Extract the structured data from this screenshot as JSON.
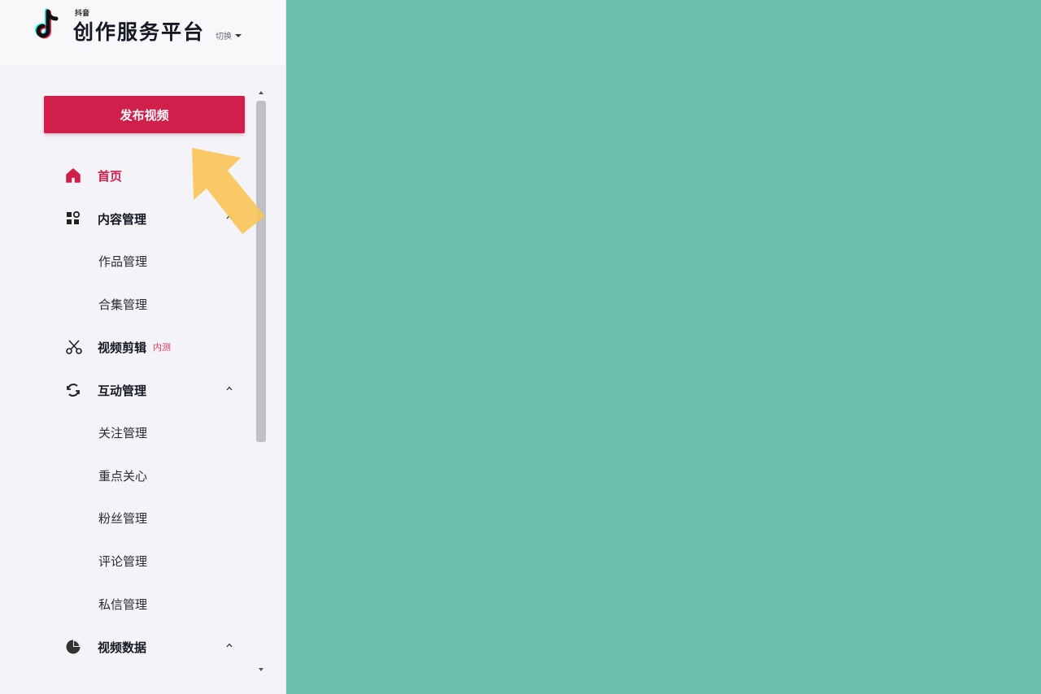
{
  "app": {
    "logo_small_text": "抖音",
    "title": "创作服务平台",
    "role_label": "切换"
  },
  "sidebar": {
    "publish_button_label": "发布视频",
    "menu": [
      {
        "label": "首页",
        "icon": "home-icon",
        "active": true
      },
      {
        "label": "内容管理",
        "icon": "grid-icon",
        "expanded": true,
        "children": [
          "作品管理",
          "合集管理"
        ]
      },
      {
        "label": "视频剪辑",
        "icon": "scissors-icon",
        "badge": "内测"
      },
      {
        "label": "互动管理",
        "icon": "refresh-icon",
        "expanded": true,
        "children": [
          "关注管理",
          "重点关心",
          "粉丝管理",
          "评论管理",
          "私信管理"
        ]
      },
      {
        "label": "视频数据",
        "icon": "pie-chart-icon",
        "expanded": true
      }
    ]
  },
  "colors": {
    "brand": "#d01f4b",
    "content_bg": "#6cbfac",
    "sidebar_bg": "#f4f4f8",
    "annotation_arrow": "#f8c45a"
  }
}
